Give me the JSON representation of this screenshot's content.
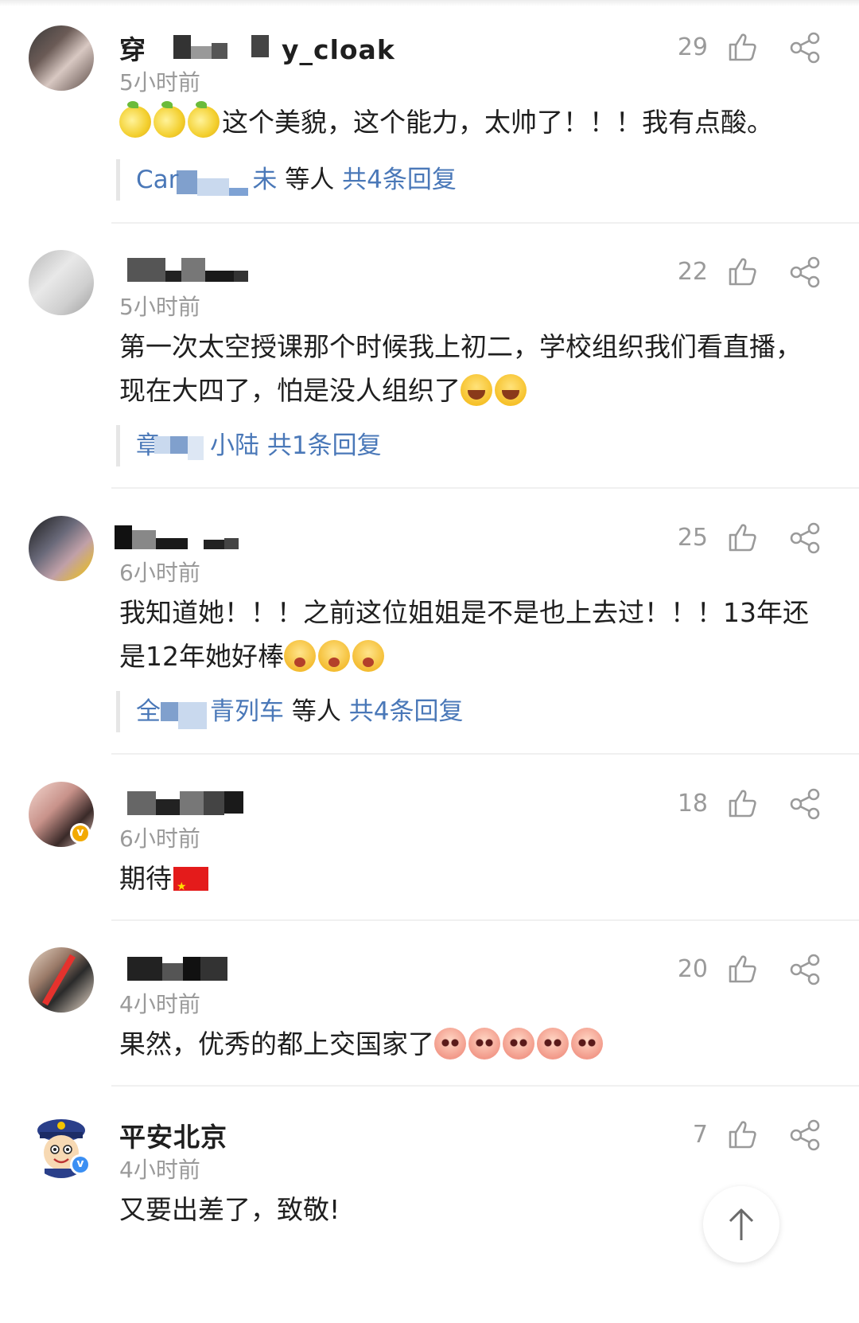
{
  "comments": [
    {
      "username": "穿　　　　　y_cloak",
      "time": "5小时前",
      "likes": "29",
      "text": "这个美貌，这个能力，太帅了！！！我有点酸。",
      "emoji_prefix": [
        "lemon",
        "lemon",
        "lemon"
      ],
      "reply": {
        "names": "Car　　　未",
        "etc": "等人",
        "count": "共4条回复"
      }
    },
    {
      "username": "",
      "time": "5小时前",
      "likes": "22",
      "text_line1": "第一次太空授课那个时候我上初二，学校组织我们看直播，",
      "text_line2": "现在大四了，怕是没人组织了",
      "emoji_suffix": [
        "laugh",
        "laugh"
      ],
      "reply": {
        "names": "章　　小陆",
        "etc": "",
        "count": "共1条回复"
      }
    },
    {
      "username": "",
      "time": "6小时前",
      "likes": "25",
      "text_line1": "我知道她！！！之前这位姐姐是不是也上去过！！！13年还",
      "text_line2": "是12年她好棒",
      "emoji_suffix": [
        "cry",
        "cry",
        "cry"
      ],
      "reply": {
        "names": "全　　青列车",
        "etc": "等人",
        "count": "共4条回复"
      }
    },
    {
      "username": "",
      "time": "6小时前",
      "likes": "18",
      "text": "期待",
      "emoji_suffix": [
        "cn-flag"
      ]
    },
    {
      "username": "",
      "time": "4小时前",
      "likes": "20",
      "text": "果然，优秀的都上交国家了",
      "emoji_suffix": [
        "octopus",
        "octopus",
        "octopus",
        "octopus",
        "octopus"
      ]
    },
    {
      "username": "平安北京",
      "time": "4小时前",
      "likes": "7",
      "text": "又要出差了，致敬!"
    }
  ],
  "colors": {
    "link": "#4a78b8",
    "meta": "#9a9a9a",
    "text": "#1f1f1f",
    "verified_orange": "#f2a900",
    "verified_blue": "#3b8ff3"
  },
  "icons": [
    "thumbs-up-icon",
    "share-icon",
    "arrow-up-icon"
  ]
}
